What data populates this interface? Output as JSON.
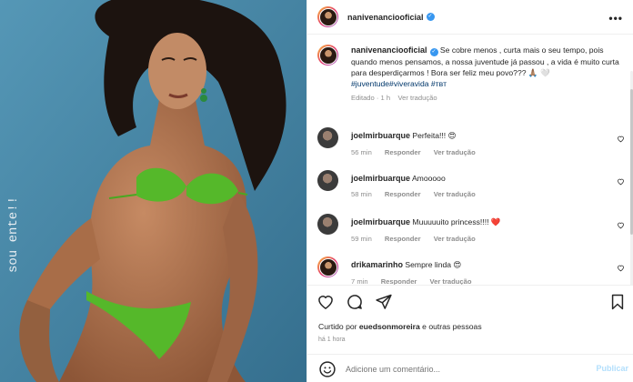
{
  "header": {
    "username": "nanivenanciooficial",
    "more_label": "•••"
  },
  "caption": {
    "username": "nanivenanciooficial",
    "text": "Se cobre menos , curta mais o seu tempo, pois quando menos pensamos, a nossa juventude já passou , a vida é muito curta para desperdiçarmos ! Bora ser feliz meu povo??? 🙏🏽 🤍",
    "hashtags": "#juventude#viveravida #ᴛʙᴛ",
    "edited": "Editado",
    "time": "1 h",
    "translate": "Ver tradução"
  },
  "comments": [
    {
      "username": "joelmirbuarque",
      "text": "Perfeita!!! 😍",
      "time": "56 min",
      "reply": "Responder",
      "translate": "Ver tradução"
    },
    {
      "username": "joelmirbuarque",
      "text": "Amooooo",
      "time": "58 min",
      "reply": "Responder",
      "translate": "Ver tradução"
    },
    {
      "username": "joelmirbuarque",
      "text": "Muuuuuito princess!!!! ❤️",
      "time": "59 min",
      "reply": "Responder",
      "translate": "Ver tradução"
    },
    {
      "username": "drikamarinho",
      "text": "Sempre linda 😍",
      "time": "7 min",
      "reply": "Responder",
      "translate": "Ver tradução"
    }
  ],
  "likes": {
    "prefix": "Curtido por",
    "user": "euedsonmoreira",
    "suffix": "e outras pessoas"
  },
  "posted_ago": "há 1 hora",
  "composer": {
    "placeholder": "Adicione um comentário...",
    "publish_label": "Publicar"
  },
  "photo": {
    "side_text": "sou ente!!"
  },
  "icons": [
    "like-icon",
    "comment-icon",
    "share-icon",
    "save-icon",
    "emoji-icon",
    "heart-icon"
  ],
  "colors": {
    "link": "#00376b",
    "verified": "#3897f0",
    "muted": "#8e8e8e",
    "heart": "#ed4956",
    "publish": "#b2dffc",
    "photo_bg": "#3f82a3"
  }
}
